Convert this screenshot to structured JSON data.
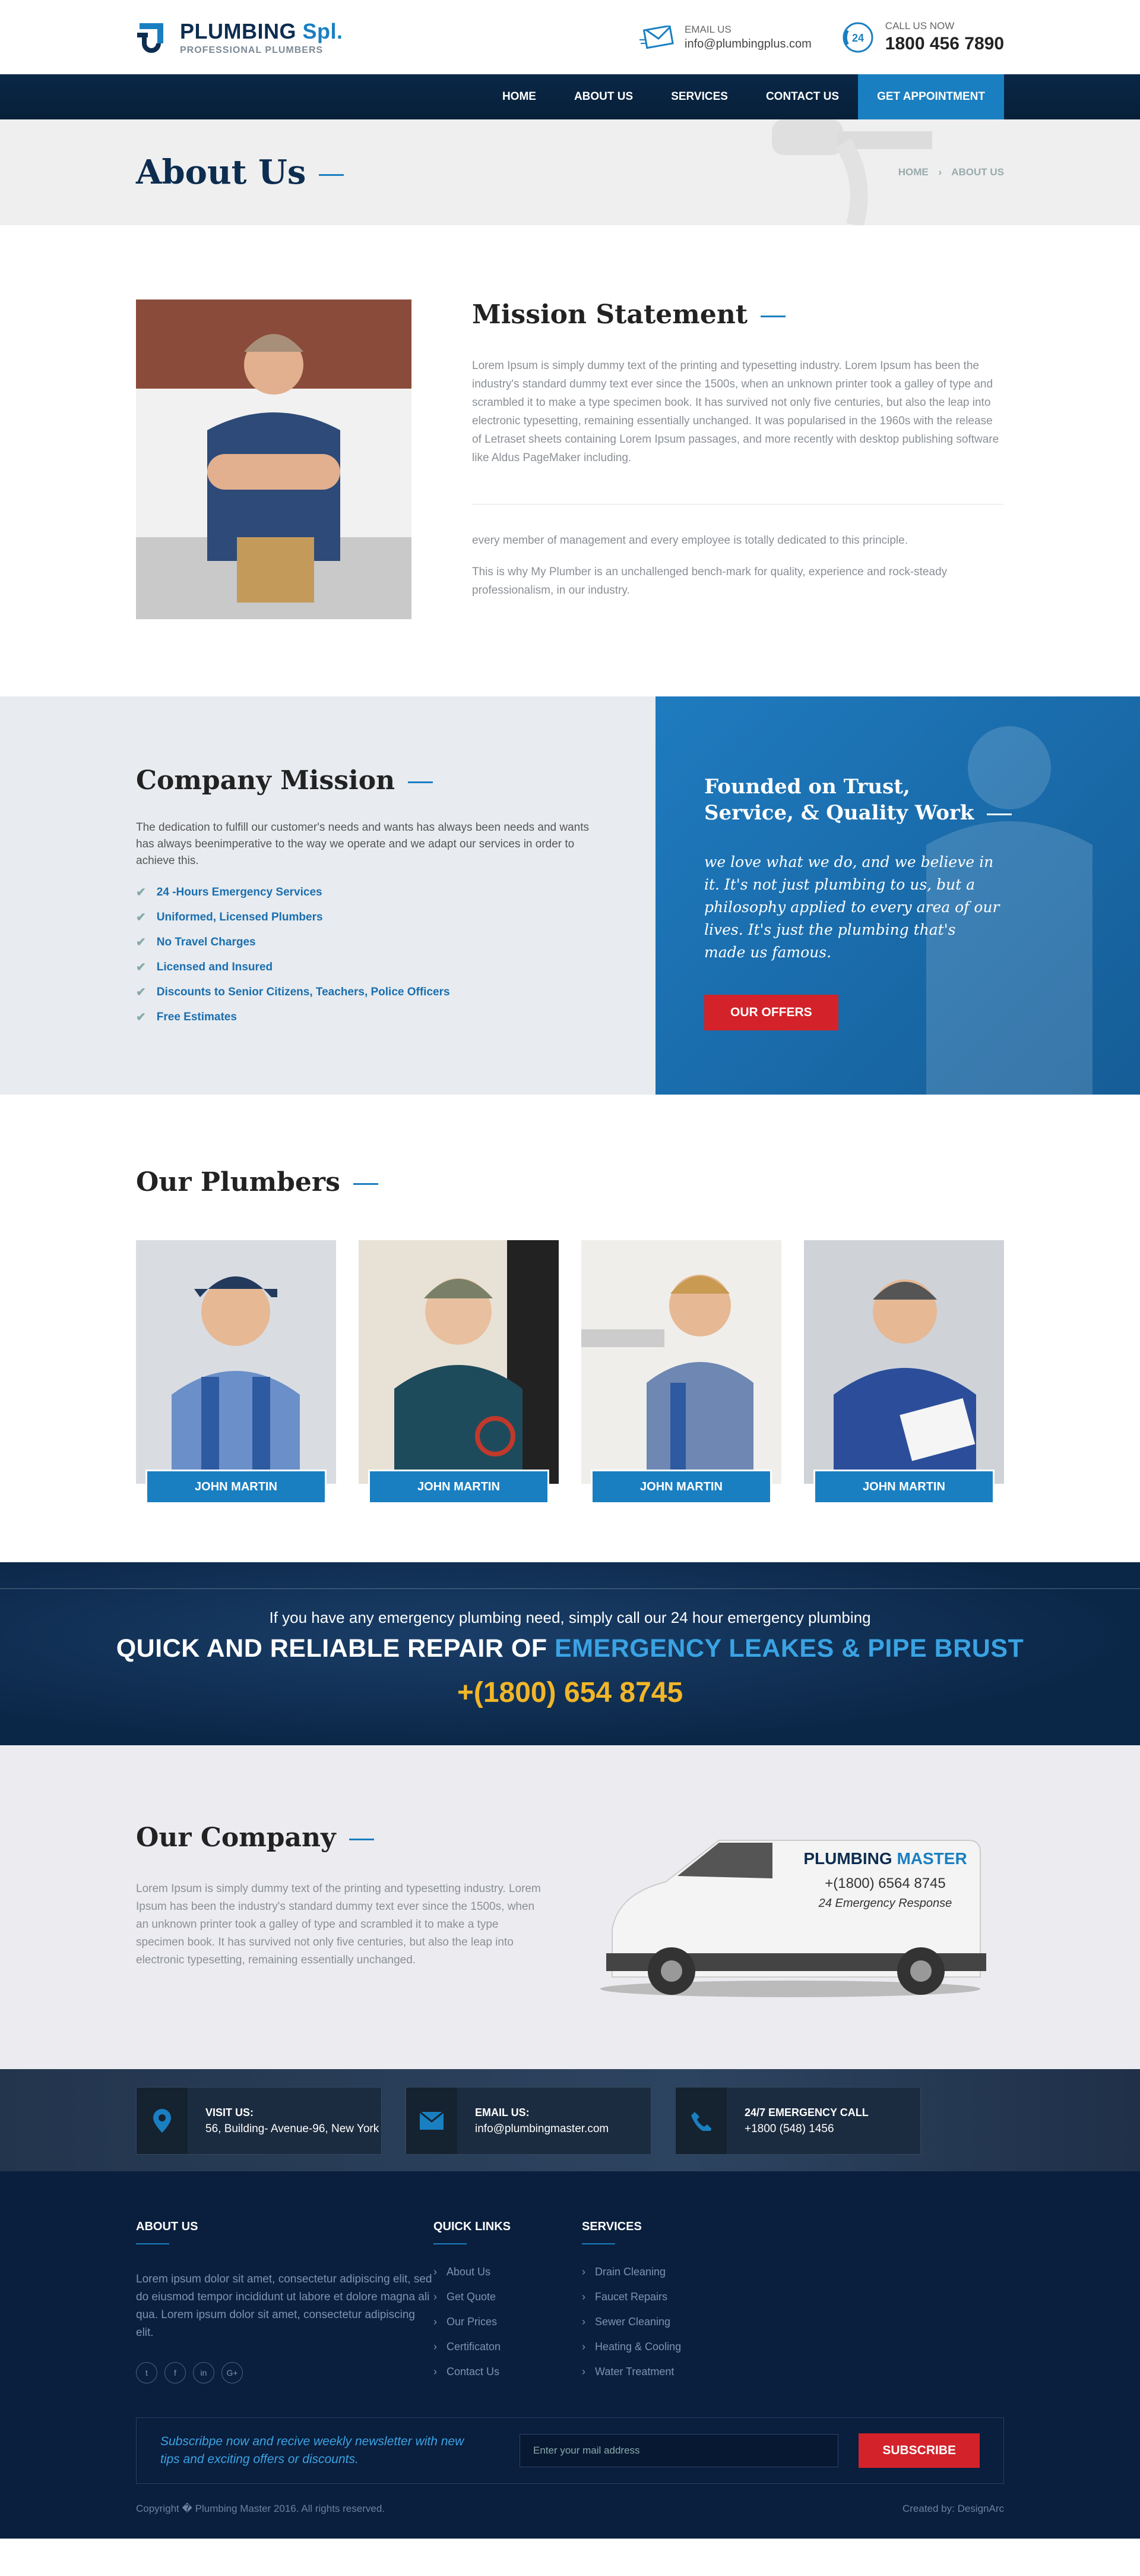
{
  "colors": {
    "brand_blue": "#1a7fc1",
    "navy": "#0a2748",
    "red": "#d32229",
    "gold": "#f1b628"
  },
  "header": {
    "logo_main": "PLUMBING",
    "logo_accent": "Spl.",
    "logo_sub": "PROFESSIONAL PLUMBERS",
    "email_label": "EMAIL US",
    "email_value": "info@plumbingplus.com",
    "call_label": "CALL US NOW",
    "call_value": "1800 456 7890",
    "call_badge": "24"
  },
  "nav": {
    "items": [
      {
        "label": "HOME"
      },
      {
        "label": "ABOUT US"
      },
      {
        "label": "SERVICES"
      },
      {
        "label": "CONTACT US"
      }
    ],
    "cta": "GET APPOINTMENT"
  },
  "pagehead": {
    "title": "About Us",
    "crumb_home": "HOME",
    "crumb_sep": "›",
    "crumb_current": "ABOUT US"
  },
  "mission": {
    "title": "Mission Statement",
    "p1": "Lorem Ipsum is simply dummy text of the printing and typesetting industry. Lorem Ipsum has been the industry's standard dummy text ever since the 1500s, when an unknown printer took a galley of type and scrambled it to make a type specimen book. It has survived not only five centuries, but also the leap into electronic typesetting, remaining essentially unchanged. It was popularised in the 1960s with the release of Letraset sheets containing Lorem Ipsum passages, and more recently with desktop publishing software like Aldus PageMaker including.",
    "p2": "every member of management and every employee is totally dedicated to this principle.",
    "p3": "This is why My Plumber is an unchallenged bench-mark for quality, experience and rock-steady professionalism, in our industry."
  },
  "company_mission": {
    "title": "Company Mission",
    "desc": "The dedication to fulfill our customer's needs and wants has always been needs and wants has always beenimperative to the way we operate and we adapt our services in order to achieve this.",
    "items": [
      "24 -Hours Emergency Services",
      "Uniformed, Licensed Plumbers",
      "No Travel Charges",
      "Licensed and Insured",
      "Discounts to Senior Citizens, Teachers, Police Officers",
      "Free Estimates"
    ],
    "check": "✔"
  },
  "founded": {
    "title_line1": "Founded on Trust,",
    "title_line2": "Service, & Quality Work",
    "quote": "we love what we do, and we believe in it. It's not just plumbing to us, but a philosophy applied to every area of our lives. It's just the plumbing that's made us famous.",
    "button": "OUR OFFERS"
  },
  "plumbers": {
    "title": "Our Plumbers",
    "list": [
      {
        "name": "JOHN MARTIN"
      },
      {
        "name": "JOHN MARTIN"
      },
      {
        "name": "JOHN MARTIN"
      },
      {
        "name": "JOHN MARTIN"
      }
    ]
  },
  "emergency": {
    "line1": "If you have any emergency plumbing need, simply call our 24 hour emergency plumbing",
    "line2_a": "QUICK AND RELIABLE REPAIR OF ",
    "line2_b": "EMERGENCY LEAKES & PIPE BRUST",
    "phone": "+(1800) 654 8745"
  },
  "our_company": {
    "title": "Our Company",
    "text": "Lorem Ipsum is simply dummy text of the printing and typesetting industry. Lorem Ipsum has been the industry's standard dummy text ever since the 1500s, when an unknown printer took a galley of type and scrambled it to make a type specimen book. It has survived not only five centuries, but also the leap into electronic typesetting, remaining essentially unchanged.",
    "van_brand_a": "PLUMBING",
    "van_brand_b": "MASTER",
    "van_phone": "+(1800) 6564 8745",
    "van_tag": "24 Emergency Response"
  },
  "contact_strip": [
    {
      "label": "VISIT US:",
      "value": "56, Building- Avenue-96, New York",
      "icon": "map-pin-icon"
    },
    {
      "label": "EMAIL US:",
      "value": "info@plumbingmaster.com",
      "icon": "envelope-icon"
    },
    {
      "label": "24/7 EMERGENCY CALL",
      "value": "+1800 (548) 1456",
      "icon": "phone-icon"
    }
  ],
  "footer": {
    "about_title": "ABOUT US",
    "about_text": "Lorem ipsum dolor sit amet, consectetur adipiscing elit, sed do eiusmod tempor incididunt ut labore et dolore magna ali qua. Lorem ipsum dolor sit amet, consectetur adipiscing elit.",
    "socials": [
      "twitter-icon",
      "facebook-icon",
      "linkedin-icon",
      "google-plus-icon"
    ],
    "social_glyphs": [
      "t",
      "f",
      "in",
      "G+"
    ],
    "quick_title": "QUICK LINKS",
    "quick_links": [
      "About Us",
      "Get Quote",
      "Our Prices",
      "Certificaton",
      "Contact Us"
    ],
    "services_title": "SERVICES",
    "services": [
      "Drain Cleaning",
      "Faucet Repairs",
      "Sewer Cleaning",
      "Heating & Cooling",
      "Water Treatment"
    ],
    "newsletter_text": "Subscribpe now and recive weekly newsletter with new tips and exciting offers or discounts.",
    "newsletter_placeholder": "Enter your mail address",
    "subscribe": "SUBSCRIBE",
    "copyright": "Copyright � Plumbing Master 2016. All rights reserved.",
    "credit": "Created by: DesignArc"
  }
}
